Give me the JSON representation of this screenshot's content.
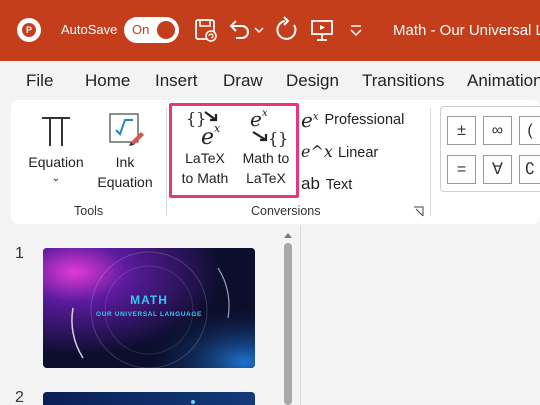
{
  "titlebar": {
    "autosave_label": "AutoSave",
    "autosave_state": "On",
    "doc_title": "Math - Our Universal L",
    "icons": [
      "powerpoint-logo-icon",
      "save-icon",
      "undo-icon",
      "undo-dropdown-icon",
      "redo-icon",
      "present-icon",
      "customize-qat-icon"
    ]
  },
  "menu": [
    "File",
    "Home",
    "Insert",
    "Draw",
    "Design",
    "Transitions",
    "Animation"
  ],
  "ribbon": {
    "equation_label": "Equation",
    "ink_label_1": "Ink",
    "ink_label_2": "Equation",
    "tools_group": "Tools",
    "latex_to_math_1": "LaTeX",
    "latex_to_math_2": "to Math",
    "math_to_latex_1": "Math to",
    "math_to_latex_2": "LaTeX",
    "professional": "Professional",
    "linear": "Linear",
    "text": "Text",
    "conversions_group": "Conversions",
    "symbols": [
      "±",
      "∞",
      "=",
      "∀"
    ]
  },
  "slides": {
    "numbers": [
      "1",
      "2"
    ],
    "slide1_title": "MATH",
    "slide1_subtitle": "OUR UNIVERSAL LANGUAGE"
  },
  "colors": {
    "accent": "#c43e1c",
    "highlight": "#e8357e"
  }
}
